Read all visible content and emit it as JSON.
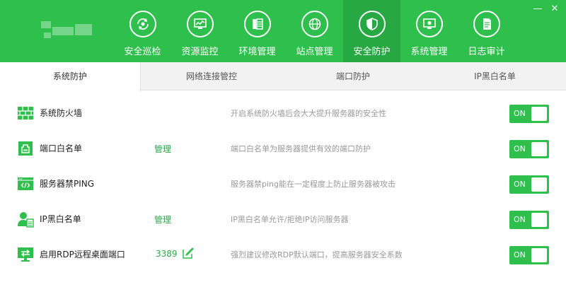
{
  "colors": {
    "brand": "#2fbf4d",
    "brand_dark": "#27a842",
    "link": "#2aa84a"
  },
  "window": {
    "minimize": "—",
    "close": "✕"
  },
  "nav": [
    {
      "label": "安全巡检",
      "icon": "refresh-eye-icon",
      "active": false
    },
    {
      "label": "资源监控",
      "icon": "monitor-chart-icon",
      "active": false
    },
    {
      "label": "环境管理",
      "icon": "server-rack-icon",
      "active": false
    },
    {
      "label": "站点管理",
      "icon": "globe-icon",
      "active": false
    },
    {
      "label": "安全防护",
      "icon": "shield-icon",
      "active": true
    },
    {
      "label": "系统管理",
      "icon": "gear-monitor-icon",
      "active": false
    },
    {
      "label": "日志审计",
      "icon": "document-icon",
      "active": false
    }
  ],
  "tabs": [
    {
      "label": "系统防护",
      "active": true
    },
    {
      "label": "网络连接管控",
      "active": false
    },
    {
      "label": "端口防护",
      "active": false
    },
    {
      "label": "IP黑白名单",
      "active": false
    }
  ],
  "rows": [
    {
      "title": "系统防火墙",
      "icon": "brick-wall-icon",
      "link": "",
      "desc": "开启系统防火墙后会大大提升服务器的安全性",
      "toggle": "ON"
    },
    {
      "title": "端口白名单",
      "icon": "port-icon",
      "link": "管理",
      "desc": "端口白名单为服务器提供有效的端口防护",
      "toggle": "ON"
    },
    {
      "title": "服务器禁PING",
      "icon": "code-window-icon",
      "link": "",
      "desc": "服务器禁ping能在一定程度上防止服务器被攻击",
      "toggle": "ON"
    },
    {
      "title": "IP黑白名单",
      "icon": "user-list-icon",
      "link": "管理",
      "desc": "IP黑白名单允许/拒绝IP访问服务器",
      "toggle": "ON"
    },
    {
      "title": "启用RDP远程桌面端口",
      "icon": "remote-desktop-icon",
      "port": "3389",
      "desc": "强烈建议修改RDP默认端口，提高服务器安全系数",
      "toggle": "ON"
    }
  ]
}
